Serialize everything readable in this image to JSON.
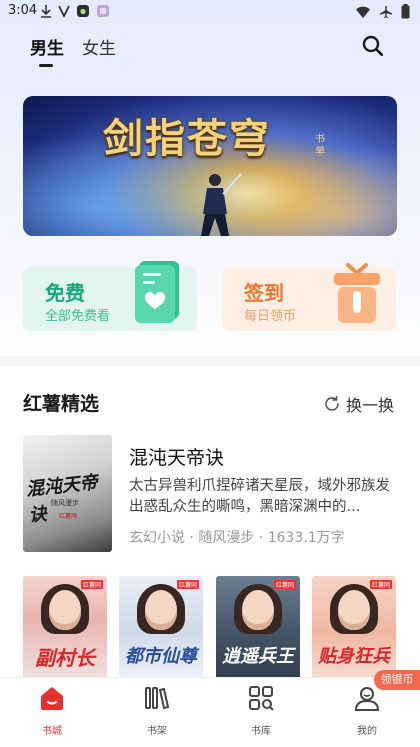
{
  "status_bar": {
    "time": "3:04"
  },
  "header": {
    "tabs": [
      {
        "label": "男生",
        "active": true
      },
      {
        "label": "女生",
        "active": false
      }
    ],
    "search_icon": "search-icon"
  },
  "banner": {
    "title": "剑指苍穹",
    "tag": "书单"
  },
  "quick_cards": {
    "free": {
      "title": "免费",
      "subtitle": "全部免费看",
      "color": "#15a97a"
    },
    "sign": {
      "title": "签到",
      "subtitle": "每日领币",
      "color": "#f0742e"
    }
  },
  "section": {
    "title": "红薯精选",
    "refresh_label": "换一换"
  },
  "featured_book": {
    "title": "混沌天帝诀",
    "description": "太古异兽利爪捏碎诸天星辰，域外邪族发出惑乱众生的嘶鸣，黑暗深渊中的...",
    "meta": "玄幻小说 · 随风漫步 · 1633.1万字",
    "cover_title": "混沌天帝诀",
    "cover_author": "随风漫步",
    "cover_logo": "红薯网"
  },
  "covers": [
    {
      "title": "副村长",
      "logo": "红薯网"
    },
    {
      "title": "都市仙尊",
      "logo": "红薯网"
    },
    {
      "title": "逍遥兵王",
      "logo": "红薯网"
    },
    {
      "title": "贴身狂兵",
      "logo": "红薯网"
    }
  ],
  "coin_badge": "领银币",
  "bottom_nav": [
    {
      "label": "书城",
      "icon": "home-icon",
      "active": true
    },
    {
      "label": "书架",
      "icon": "bookshelf-icon",
      "active": false
    },
    {
      "label": "书库",
      "icon": "library-icon",
      "active": false
    },
    {
      "label": "我的",
      "icon": "profile-icon",
      "active": false
    }
  ],
  "colors": {
    "accent": "#e8322f",
    "free_green": "#15a97a",
    "sign_orange": "#f0742e"
  }
}
